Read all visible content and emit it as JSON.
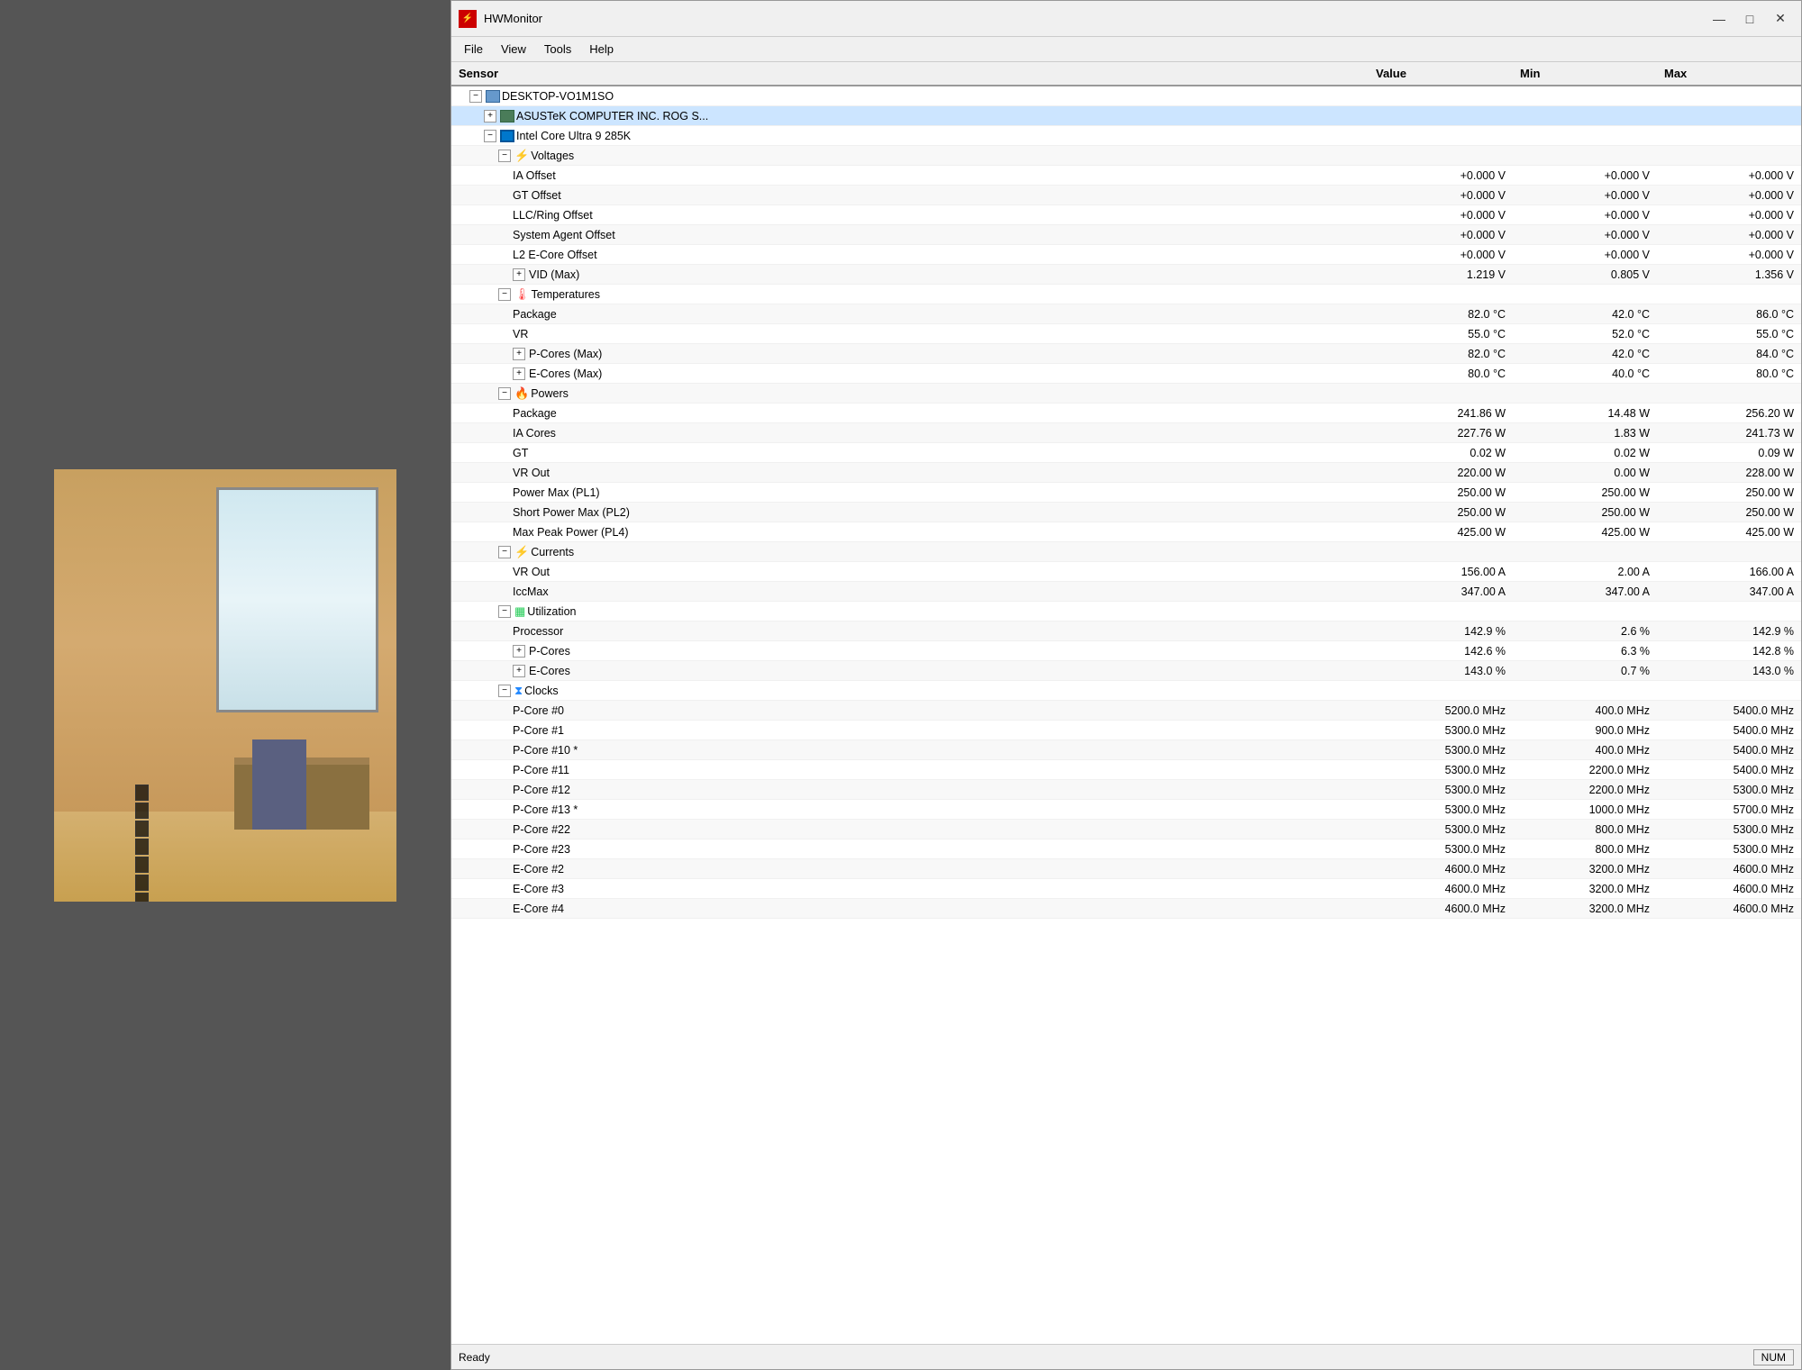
{
  "window": {
    "title": "HWMonitor",
    "icon": "⚡",
    "minimize": "—",
    "maximize": "□",
    "close": "✕"
  },
  "menu": {
    "items": [
      "File",
      "View",
      "Tools",
      "Help"
    ]
  },
  "columns": {
    "sensor": "Sensor",
    "value": "Value",
    "min": "Min",
    "max": "Max"
  },
  "tree": {
    "computer": "DESKTOP-VO1M1SO",
    "motherboard": "ASUSTeK COMPUTER INC. ROG S...",
    "cpu": "Intel Core Ultra 9 285K",
    "categories": {
      "voltages": "Voltages",
      "temperatures": "Temperatures",
      "powers": "Powers",
      "currents": "Currents",
      "utilization": "Utilization",
      "clocks": "Clocks"
    },
    "voltage_rows": [
      {
        "name": "IA Offset",
        "value": "+0.000 V",
        "min": "+0.000 V",
        "max": "+0.000 V"
      },
      {
        "name": "GT Offset",
        "value": "+0.000 V",
        "min": "+0.000 V",
        "max": "+0.000 V"
      },
      {
        "name": "LLC/Ring Offset",
        "value": "+0.000 V",
        "min": "+0.000 V",
        "max": "+0.000 V"
      },
      {
        "name": "System Agent Offset",
        "value": "+0.000 V",
        "min": "+0.000 V",
        "max": "+0.000 V"
      },
      {
        "name": "L2 E-Core Offset",
        "value": "+0.000 V",
        "min": "+0.000 V",
        "max": "+0.000 V"
      },
      {
        "name": "VID (Max)",
        "value": "1.219 V",
        "min": "0.805 V",
        "max": "1.356 V"
      }
    ],
    "temp_rows": [
      {
        "name": "Package",
        "value": "82.0 °C",
        "min": "42.0 °C",
        "max": "86.0 °C"
      },
      {
        "name": "VR",
        "value": "55.0 °C",
        "min": "52.0 °C",
        "max": "55.0 °C"
      },
      {
        "name": "P-Cores (Max)",
        "value": "82.0 °C",
        "min": "42.0 °C",
        "max": "84.0 °C",
        "expandable": true
      },
      {
        "name": "E-Cores (Max)",
        "value": "80.0 °C",
        "min": "40.0 °C",
        "max": "80.0 °C",
        "expandable": true
      }
    ],
    "power_rows": [
      {
        "name": "Package",
        "value": "241.86 W",
        "min": "14.48 W",
        "max": "256.20 W"
      },
      {
        "name": "IA Cores",
        "value": "227.76 W",
        "min": "1.83 W",
        "max": "241.73 W"
      },
      {
        "name": "GT",
        "value": "0.02 W",
        "min": "0.02 W",
        "max": "0.09 W"
      },
      {
        "name": "VR Out",
        "value": "220.00 W",
        "min": "0.00 W",
        "max": "228.00 W"
      },
      {
        "name": "Power Max (PL1)",
        "value": "250.00 W",
        "min": "250.00 W",
        "max": "250.00 W"
      },
      {
        "name": "Short Power Max (PL2)",
        "value": "250.00 W",
        "min": "250.00 W",
        "max": "250.00 W"
      },
      {
        "name": "Max Peak Power (PL4)",
        "value": "425.00 W",
        "min": "425.00 W",
        "max": "425.00 W"
      }
    ],
    "current_rows": [
      {
        "name": "VR Out",
        "value": "156.00 A",
        "min": "2.00 A",
        "max": "166.00 A"
      },
      {
        "name": "IccMax",
        "value": "347.00 A",
        "min": "347.00 A",
        "max": "347.00 A"
      }
    ],
    "util_rows": [
      {
        "name": "Processor",
        "value": "142.9 %",
        "min": "2.6 %",
        "max": "142.9 %"
      },
      {
        "name": "P-Cores",
        "value": "142.6 %",
        "min": "6.3 %",
        "max": "142.8 %",
        "expandable": true
      },
      {
        "name": "E-Cores",
        "value": "143.0 %",
        "min": "0.7 %",
        "max": "143.0 %",
        "expandable": true
      }
    ],
    "clock_rows": [
      {
        "name": "P-Core #0",
        "value": "5200.0 MHz",
        "min": "400.0 MHz",
        "max": "5400.0 MHz"
      },
      {
        "name": "P-Core #1",
        "value": "5300.0 MHz",
        "min": "900.0 MHz",
        "max": "5400.0 MHz"
      },
      {
        "name": "P-Core #10 *",
        "value": "5300.0 MHz",
        "min": "400.0 MHz",
        "max": "5400.0 MHz"
      },
      {
        "name": "P-Core #11",
        "value": "5300.0 MHz",
        "min": "2200.0 MHz",
        "max": "5400.0 MHz"
      },
      {
        "name": "P-Core #12",
        "value": "5300.0 MHz",
        "min": "2200.0 MHz",
        "max": "5300.0 MHz"
      },
      {
        "name": "P-Core #13 *",
        "value": "5300.0 MHz",
        "min": "1000.0 MHz",
        "max": "5700.0 MHz"
      },
      {
        "name": "P-Core #22",
        "value": "5300.0 MHz",
        "min": "800.0 MHz",
        "max": "5300.0 MHz"
      },
      {
        "name": "P-Core #23",
        "value": "5300.0 MHz",
        "min": "800.0 MHz",
        "max": "5300.0 MHz"
      },
      {
        "name": "E-Core #2",
        "value": "4600.0 MHz",
        "min": "3200.0 MHz",
        "max": "4600.0 MHz"
      },
      {
        "name": "E-Core #3",
        "value": "4600.0 MHz",
        "min": "3200.0 MHz",
        "max": "4600.0 MHz"
      },
      {
        "name": "E-Core #4",
        "value": "4600.0 MHz",
        "min": "3200.0 MHz",
        "max": "4600.0 MHz"
      }
    ]
  },
  "status": {
    "text": "Ready",
    "num_badge": "NUM"
  }
}
